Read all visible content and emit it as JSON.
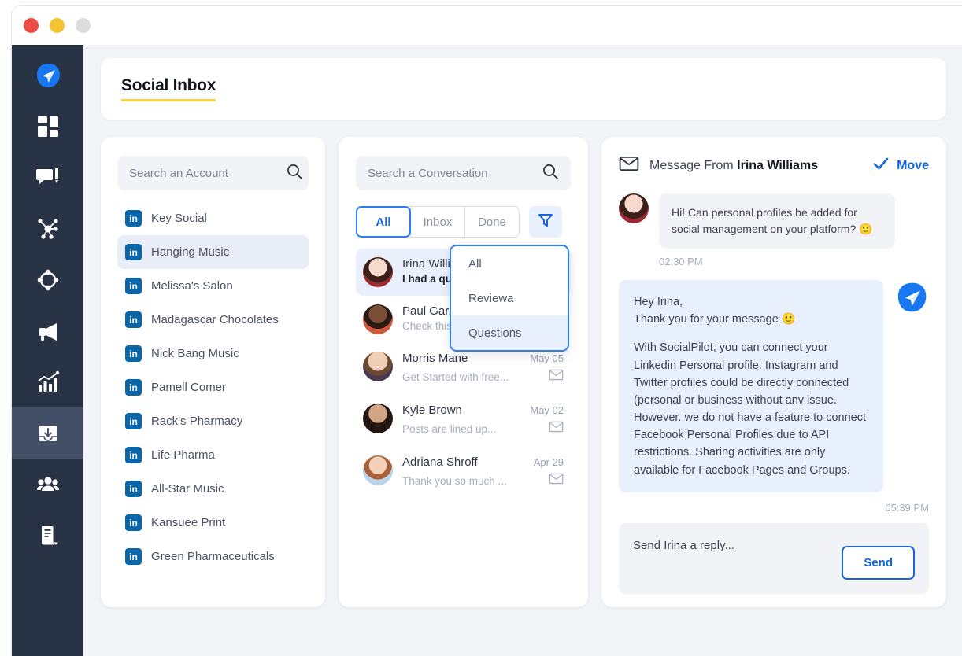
{
  "window": {
    "traffic_lights": [
      "red",
      "yellow",
      "grey"
    ]
  },
  "sidebar": {
    "items": [
      {
        "name": "logo",
        "icon": "paper-plane-icon",
        "active": false
      },
      {
        "name": "dashboard",
        "icon": "dashboard-grid-icon",
        "active": false
      },
      {
        "name": "compose",
        "icon": "chat-compose-icon",
        "active": false
      },
      {
        "name": "network",
        "icon": "network-nodes-icon",
        "active": false
      },
      {
        "name": "targeting",
        "icon": "target-diamond-icon",
        "active": false
      },
      {
        "name": "campaigns",
        "icon": "megaphone-icon",
        "active": false
      },
      {
        "name": "analytics",
        "icon": "bar-chart-icon",
        "active": false
      },
      {
        "name": "inbox",
        "icon": "inbox-download-icon",
        "active": true
      },
      {
        "name": "team",
        "icon": "users-group-icon",
        "active": false
      },
      {
        "name": "reports",
        "icon": "document-icon",
        "active": false
      }
    ]
  },
  "header": {
    "title": "Social Inbox"
  },
  "accounts_panel": {
    "search": {
      "placeholder": "Search an Account",
      "value": "",
      "icon": "search-icon"
    },
    "items": [
      {
        "label": "Key Social",
        "network": "linkedin",
        "selected": false
      },
      {
        "label": "Hanging Music",
        "network": "linkedin",
        "selected": true
      },
      {
        "label": "Melissa's Salon",
        "network": "linkedin",
        "selected": false
      },
      {
        "label": "Madagascar Chocolates",
        "network": "linkedin",
        "selected": false
      },
      {
        "label": "Nick Bang Music",
        "network": "linkedin",
        "selected": false
      },
      {
        "label": "Pamell Comer",
        "network": "linkedin",
        "selected": false
      },
      {
        "label": "Rack's Pharmacy",
        "network": "linkedin",
        "selected": false
      },
      {
        "label": "Life Pharma",
        "network": "linkedin",
        "selected": false
      },
      {
        "label": "All-Star Music",
        "network": "linkedin",
        "selected": false
      },
      {
        "label": "Kansuee Print",
        "network": "linkedin",
        "selected": false
      },
      {
        "label": "Green Pharmaceuticals",
        "network": "linkedin",
        "selected": false
      }
    ],
    "network_badge_text": "in"
  },
  "conversations_panel": {
    "search": {
      "placeholder": "Search a Conversation",
      "value": "",
      "icon": "search-icon"
    },
    "tabs": [
      {
        "label": "All",
        "active": true
      },
      {
        "label": "Inbox",
        "active": false
      },
      {
        "label": "Done",
        "active": false
      }
    ],
    "filter_button": {
      "icon": "filter-funnel-icon"
    },
    "filter_dropdown": {
      "open": true,
      "options": [
        {
          "label": "All",
          "active": false
        },
        {
          "label": "Reviewa",
          "active": false
        },
        {
          "label": "Questions",
          "active": true
        }
      ]
    },
    "items": [
      {
        "name": "Irina Williams",
        "preview": "I had a qu...",
        "date": "",
        "selected": true,
        "unread_icon": ""
      },
      {
        "name": "Paul Gar...",
        "preview": "Check this...",
        "date": "",
        "selected": false,
        "unread_icon": ""
      },
      {
        "name": "Morris Mane",
        "preview": "Get Started with free...",
        "date": "May 05",
        "selected": false,
        "unread_icon": "envelope-icon"
      },
      {
        "name": "Kyle Brown",
        "preview": "Posts are lined up...",
        "date": "May 02",
        "selected": false,
        "unread_icon": "envelope-icon"
      },
      {
        "name": "Adriana Shroff",
        "preview": "Thank you so much ...",
        "date": "Apr 29",
        "selected": false,
        "unread_icon": "envelope-icon"
      }
    ]
  },
  "message_panel": {
    "header": {
      "icon": "envelope-icon",
      "prefix": "Message From",
      "sender": "Irina Williams",
      "move_label": "Move",
      "move_icon": "check-icon"
    },
    "incoming": {
      "text": "Hi! Can personal profiles be added for social management on your platform? 🙂",
      "time": "02:30 PM"
    },
    "outgoing": {
      "greeting": "Hey Irina,",
      "thanks": "Thank you for your message 🙂",
      "body": "With SocialPilot, you can connect your Linkedin Personal profile. Instagram and Twitter profiles could be directly connected (personal or business without anv issue. However. we do not have a feature to connect Facebook Personal Profiles due to API restrictions. Sharing activities are only available for Facebook Pages and Groups.",
      "time": "05:39 PM",
      "icon": "paper-plane-icon"
    },
    "reply": {
      "placeholder": "Send Irina a reply...",
      "value": "",
      "send_label": "Send"
    }
  },
  "colors": {
    "sidebar_bg": "#283346",
    "sidebar_active": "#434f66",
    "accent_blue": "#1565d8",
    "accent_light_blue": "#e8f0fd",
    "underline_yellow": "#f7d548",
    "linkedin_blue": "#0a66a8",
    "page_bg": "#f3f4f7"
  }
}
